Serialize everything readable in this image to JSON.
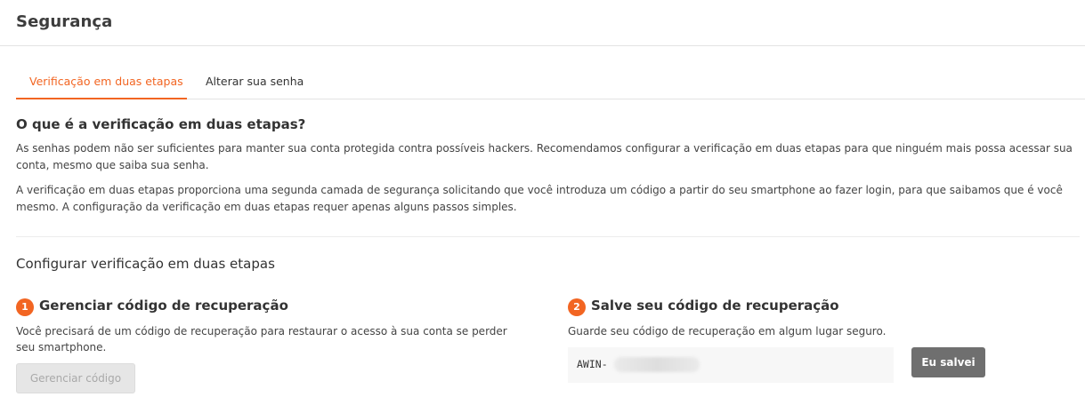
{
  "header": {
    "title": "Segurança"
  },
  "tabs": [
    {
      "label": "Verificação em duas etapas",
      "active": true
    },
    {
      "label": "Alterar sua senha",
      "active": false
    }
  ],
  "intro": {
    "heading": "O que é a verificação em duas etapas?",
    "paragraph_1": "As senhas podem não ser suficientes para manter sua conta protegida contra possíveis hackers. Recomendamos configurar a verificação em duas etapas para que ninguém mais possa acessar sua conta, mesmo que saiba sua senha.",
    "paragraph_2": "A verificação em duas etapas proporciona uma segunda camada de segurança solicitando que você introduza um código a partir do seu smartphone ao fazer login, para que saibamos que é você mesmo. A configuração da verificação em duas etapas requer apenas alguns passos simples."
  },
  "setup": {
    "heading": "Configurar verificação em duas etapas",
    "step1": {
      "number": "1",
      "title": "Gerenciar código de recuperação",
      "description": "Você precisará de um código de recuperação para restaurar o acesso à sua conta se perder seu smartphone.",
      "button_label": "Gerenciar código"
    },
    "step2": {
      "number": "2",
      "title": "Salve seu código de recuperação",
      "description": "Guarde seu código de recuperação em algum lugar seguro.",
      "code_prefix": "AWIN-",
      "button_label": "Eu salvei"
    }
  },
  "colors": {
    "accent": "#f26522",
    "text": "#333333",
    "divider": "#e3e3e3",
    "primary_button": "#6f6f6f",
    "disabled_button": "#e6e6e6"
  }
}
